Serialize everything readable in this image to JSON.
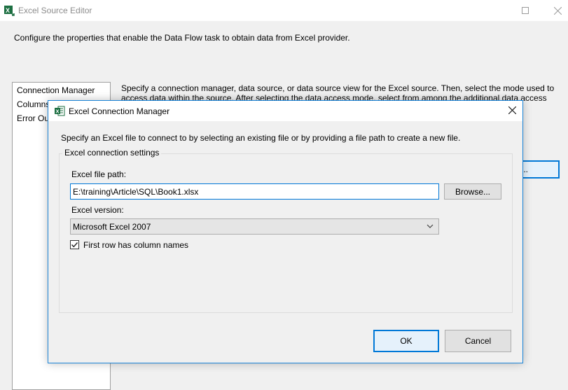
{
  "outer": {
    "title": "Excel Source Editor",
    "description": "Configure the properties that enable the Data Flow task to obtain data from Excel provider.",
    "nav": [
      "Connection Manager",
      "Columns",
      "Error Output"
    ],
    "right_description": "Specify a connection manager, data source, or data source view for the Excel source. Then, select the mode used to access data within the source. After selecting the data access mode, select from among the additional data access",
    "partial_button": "..."
  },
  "dialog": {
    "title": "Excel Connection Manager",
    "instructions": "Specify an Excel file to connect to by selecting an existing file or by providing a file path to create a new file.",
    "group_label": "Excel connection settings",
    "path_label": "Excel file path:",
    "path_value": "E:\\training\\Article\\SQL\\Book1.xlsx",
    "browse_label": "Browse...",
    "version_label": "Excel version:",
    "version_value": "Microsoft Excel 2007",
    "checkbox_label": "First row has column names",
    "checkbox_checked": true,
    "ok_label": "OK",
    "cancel_label": "Cancel"
  },
  "colors": {
    "accent": "#0078d7",
    "window_bg": "#f0f0f0",
    "button_bg": "#e1e1e1"
  },
  "icons": {
    "outer_app": "excel-source-icon",
    "dialog": "excel-icon",
    "maximize": "maximize-icon",
    "close": "close-icon",
    "dropdown": "chevron-down-icon",
    "check": "checkmark-icon"
  }
}
